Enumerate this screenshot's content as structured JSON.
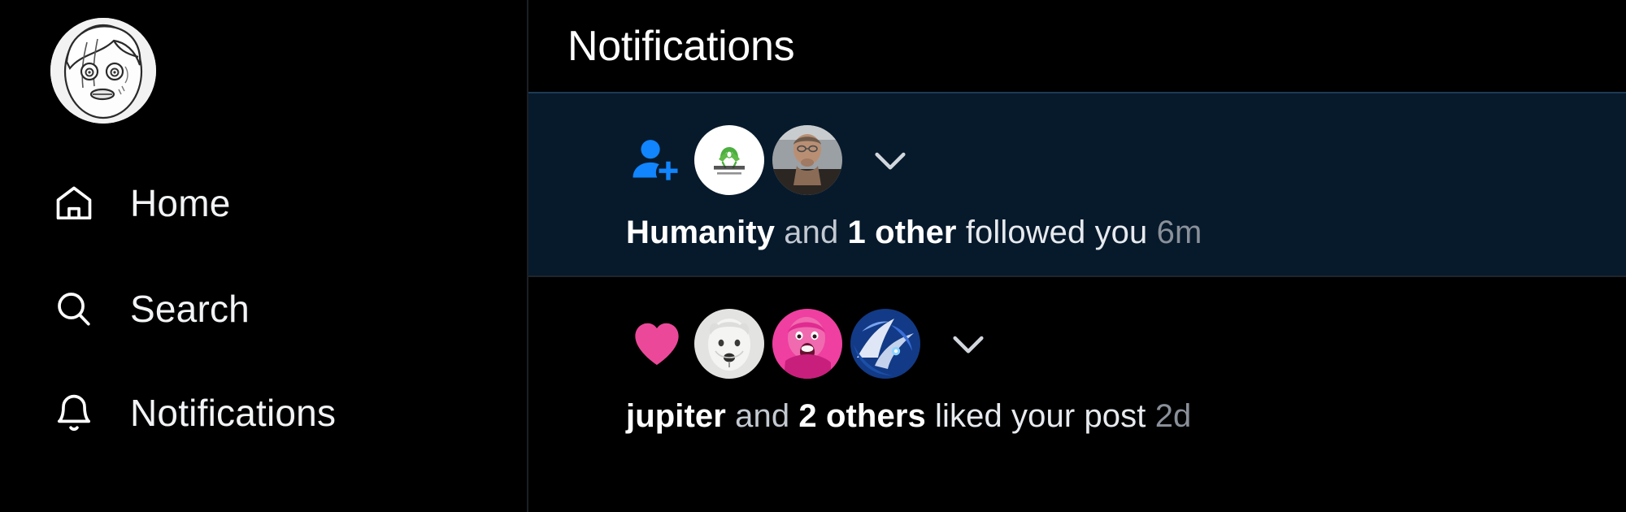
{
  "sidebar": {
    "avatar": {
      "name": "user-avatar",
      "alt": "manga character avatar"
    },
    "items": [
      {
        "id": "home",
        "label": "Home",
        "icon": "home-icon"
      },
      {
        "id": "search",
        "label": "Search",
        "icon": "search-icon"
      },
      {
        "id": "notifs",
        "label": "Notifications",
        "icon": "bell-icon"
      }
    ]
  },
  "header": {
    "title": "Notifications"
  },
  "notifications": [
    {
      "id": "follow-humanity",
      "type": "follow",
      "type_icon": "person-plus-icon",
      "unread": true,
      "actors": [
        {
          "name": "Humanity",
          "avatar": "humanity-logo-avatar"
        },
        {
          "name": "second follower",
          "avatar": "photo-person-avatar"
        }
      ],
      "name": "Humanity",
      "conjunction": "and",
      "others": "1 other",
      "action": "followed you",
      "timestamp": "6m"
    },
    {
      "id": "like-jupiter",
      "type": "like",
      "type_icon": "heart-icon",
      "unread": false,
      "actors": [
        {
          "name": "jupiter",
          "avatar": "white-dog-avatar"
        },
        {
          "name": "second liker",
          "avatar": "pink-person-avatar"
        },
        {
          "name": "third liker",
          "avatar": "blue-anime-avatar"
        }
      ],
      "name": "jupiter",
      "conjunction": "and",
      "others": "2 others",
      "action": "liked your post",
      "timestamp": "2d"
    }
  ],
  "colors": {
    "background": "#000000",
    "unread_row": "#071a2c",
    "unread_border": "#1e3a54",
    "follow_icon": "#1185fe",
    "like_icon": "#ec4899",
    "text_primary": "#ffffff",
    "text_secondary": "#8a9099"
  }
}
